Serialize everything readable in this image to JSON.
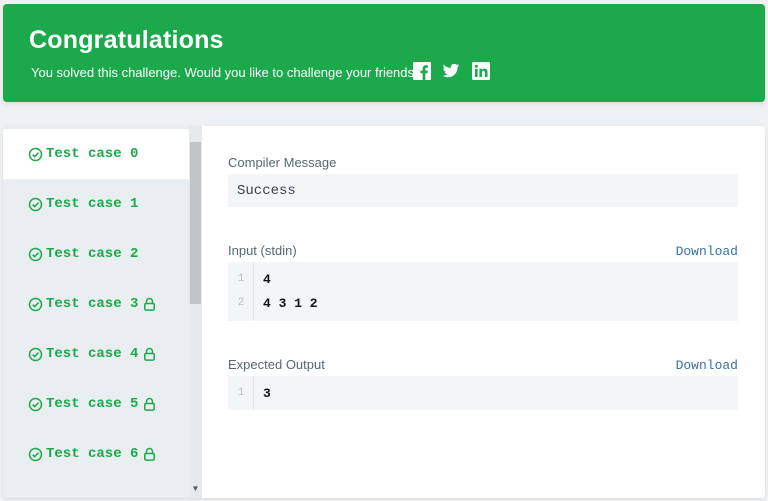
{
  "banner": {
    "title": "Congratulations",
    "message": "You solved this challenge. Would you like to challenge your friends?",
    "share_icons": [
      "facebook-icon",
      "twitter-icon",
      "linkedin-icon"
    ],
    "color": "#1ba94c"
  },
  "test_cases": [
    {
      "label": "Test case 0",
      "locked": false,
      "active": true
    },
    {
      "label": "Test case 1",
      "locked": false,
      "active": false
    },
    {
      "label": "Test case 2",
      "locked": false,
      "active": false
    },
    {
      "label": "Test case 3",
      "locked": true,
      "active": false
    },
    {
      "label": "Test case 4",
      "locked": true,
      "active": false
    },
    {
      "label": "Test case 5",
      "locked": true,
      "active": false
    },
    {
      "label": "Test case 6",
      "locked": true,
      "active": false
    }
  ],
  "compiler": {
    "label": "Compiler Message",
    "message": "Success"
  },
  "input": {
    "label": "Input (stdin)",
    "download": "Download",
    "lines": [
      {
        "n": "1",
        "text": "4"
      },
      {
        "n": "2",
        "text": "4 3 1 2"
      }
    ]
  },
  "expected": {
    "label": "Expected Output",
    "download": "Download",
    "lines": [
      {
        "n": "1",
        "text": "3"
      }
    ]
  },
  "colors": {
    "success": "#1ba94c",
    "link": "#39729e",
    "label": "#576871"
  }
}
